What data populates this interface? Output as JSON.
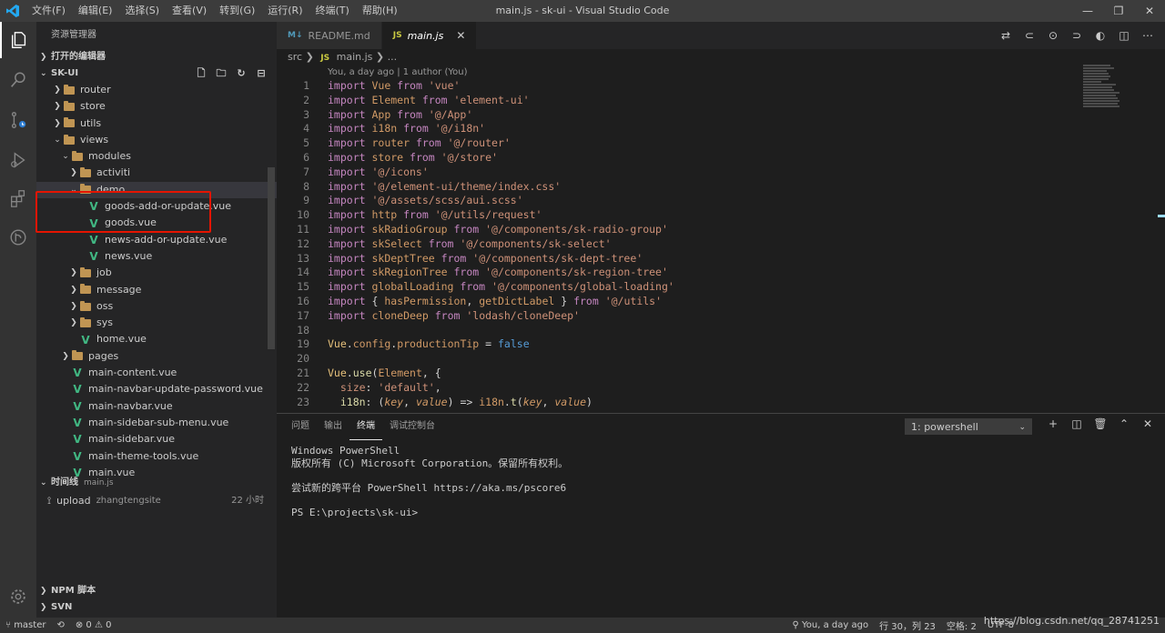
{
  "window": {
    "title": "main.js - sk-ui - Visual Studio Code",
    "menus": [
      "文件(F)",
      "编辑(E)",
      "选择(S)",
      "查看(V)",
      "转到(G)",
      "运行(R)",
      "终端(T)",
      "帮助(H)"
    ]
  },
  "sidebar": {
    "title": "资源管理器",
    "open_editors": "打开的编辑器",
    "project": "SK-UI",
    "tree": [
      {
        "label": "router",
        "type": "folder",
        "depth": 1,
        "expanded": false
      },
      {
        "label": "store",
        "type": "folder",
        "depth": 1,
        "expanded": false
      },
      {
        "label": "utils",
        "type": "folder",
        "depth": 1,
        "expanded": false
      },
      {
        "label": "views",
        "type": "folder",
        "depth": 1,
        "expanded": true
      },
      {
        "label": "modules",
        "type": "folder",
        "depth": 2,
        "expanded": true
      },
      {
        "label": "activiti",
        "type": "folder",
        "depth": 3,
        "expanded": false
      },
      {
        "label": "demo",
        "type": "folder",
        "depth": 3,
        "expanded": true
      },
      {
        "label": "goods-add-or-update.vue",
        "type": "vue",
        "depth": 4
      },
      {
        "label": "goods.vue",
        "type": "vue",
        "depth": 4
      },
      {
        "label": "news-add-or-update.vue",
        "type": "vue",
        "depth": 4
      },
      {
        "label": "news.vue",
        "type": "vue",
        "depth": 4
      },
      {
        "label": "job",
        "type": "folder",
        "depth": 3,
        "expanded": false
      },
      {
        "label": "message",
        "type": "folder",
        "depth": 3,
        "expanded": false
      },
      {
        "label": "oss",
        "type": "folder",
        "depth": 3,
        "expanded": false
      },
      {
        "label": "sys",
        "type": "folder",
        "depth": 3,
        "expanded": false
      },
      {
        "label": "home.vue",
        "type": "vue",
        "depth": 3
      },
      {
        "label": "pages",
        "type": "folder",
        "depth": 2,
        "expanded": false
      },
      {
        "label": "main-content.vue",
        "type": "vue",
        "depth": 2
      },
      {
        "label": "main-navbar-update-password.vue",
        "type": "vue",
        "depth": 2
      },
      {
        "label": "main-navbar.vue",
        "type": "vue",
        "depth": 2
      },
      {
        "label": "main-sidebar-sub-menu.vue",
        "type": "vue",
        "depth": 2
      },
      {
        "label": "main-sidebar.vue",
        "type": "vue",
        "depth": 2
      },
      {
        "label": "main-theme-tools.vue",
        "type": "vue",
        "depth": 2
      },
      {
        "label": "main.vue",
        "type": "vue",
        "depth": 2
      }
    ],
    "timeline": {
      "title": "时间线",
      "file": "main.js",
      "entry": {
        "action": "upload",
        "author": "zhangtengsite",
        "ago": "22 小时"
      }
    },
    "npm": "NPM 脚本",
    "svn": "SVN"
  },
  "tabs": [
    {
      "label": "README.md",
      "icon": "M↓",
      "active": false
    },
    {
      "label": "main.js",
      "icon": "JS",
      "active": true
    }
  ],
  "breadcrumb": {
    "folder": "src",
    "file": "main.js",
    "tail": "..."
  },
  "codelens": "You, a day ago | 1 author (You)",
  "code": [
    [
      {
        "t": "import ",
        "c": "kw"
      },
      {
        "t": "Vue ",
        "c": "id"
      },
      {
        "t": "from ",
        "c": "kw"
      },
      {
        "t": "'vue'",
        "c": "str"
      }
    ],
    [
      {
        "t": "import ",
        "c": "kw"
      },
      {
        "t": "Element ",
        "c": "id"
      },
      {
        "t": "from ",
        "c": "kw"
      },
      {
        "t": "'element-ui'",
        "c": "str"
      }
    ],
    [
      {
        "t": "import ",
        "c": "kw"
      },
      {
        "t": "App ",
        "c": "id"
      },
      {
        "t": "from ",
        "c": "kw"
      },
      {
        "t": "'@/App'",
        "c": "str"
      }
    ],
    [
      {
        "t": "import ",
        "c": "kw"
      },
      {
        "t": "i18n ",
        "c": "id"
      },
      {
        "t": "from ",
        "c": "kw"
      },
      {
        "t": "'@/i18n'",
        "c": "str"
      }
    ],
    [
      {
        "t": "import ",
        "c": "kw"
      },
      {
        "t": "router ",
        "c": "id"
      },
      {
        "t": "from ",
        "c": "kw"
      },
      {
        "t": "'@/router'",
        "c": "str"
      }
    ],
    [
      {
        "t": "import ",
        "c": "kw"
      },
      {
        "t": "store ",
        "c": "id"
      },
      {
        "t": "from ",
        "c": "kw"
      },
      {
        "t": "'@/store'",
        "c": "str"
      }
    ],
    [
      {
        "t": "import ",
        "c": "kw"
      },
      {
        "t": "'@/icons'",
        "c": "str"
      }
    ],
    [
      {
        "t": "import ",
        "c": "kw"
      },
      {
        "t": "'@/element-ui/theme/index.css'",
        "c": "str"
      }
    ],
    [
      {
        "t": "import ",
        "c": "kw"
      },
      {
        "t": "'@/assets/scss/aui.scss'",
        "c": "str"
      }
    ],
    [
      {
        "t": "import ",
        "c": "kw"
      },
      {
        "t": "http ",
        "c": "id"
      },
      {
        "t": "from ",
        "c": "kw"
      },
      {
        "t": "'@/utils/request'",
        "c": "str"
      }
    ],
    [
      {
        "t": "import ",
        "c": "kw"
      },
      {
        "t": "skRadioGroup ",
        "c": "id"
      },
      {
        "t": "from ",
        "c": "kw"
      },
      {
        "t": "'@/components/sk-radio-group'",
        "c": "str"
      }
    ],
    [
      {
        "t": "import ",
        "c": "kw"
      },
      {
        "t": "skSelect ",
        "c": "id"
      },
      {
        "t": "from ",
        "c": "kw"
      },
      {
        "t": "'@/components/sk-select'",
        "c": "str"
      }
    ],
    [
      {
        "t": "import ",
        "c": "kw"
      },
      {
        "t": "skDeptTree ",
        "c": "id"
      },
      {
        "t": "from ",
        "c": "kw"
      },
      {
        "t": "'@/components/sk-dept-tree'",
        "c": "str"
      }
    ],
    [
      {
        "t": "import ",
        "c": "kw"
      },
      {
        "t": "skRegionTree ",
        "c": "id"
      },
      {
        "t": "from ",
        "c": "kw"
      },
      {
        "t": "'@/components/sk-region-tree'",
        "c": "str"
      }
    ],
    [
      {
        "t": "import ",
        "c": "kw"
      },
      {
        "t": "globalLoading ",
        "c": "id"
      },
      {
        "t": "from ",
        "c": "kw"
      },
      {
        "t": "'@/components/global-loading'",
        "c": "str"
      }
    ],
    [
      {
        "t": "import ",
        "c": "kw"
      },
      {
        "t": "{ ",
        "c": "pl"
      },
      {
        "t": "hasPermission",
        "c": "id"
      },
      {
        "t": ", ",
        "c": "pl"
      },
      {
        "t": "getDictLabel ",
        "c": "id"
      },
      {
        "t": "} ",
        "c": "pl"
      },
      {
        "t": "from ",
        "c": "kw"
      },
      {
        "t": "'@/utils'",
        "c": "str"
      }
    ],
    [
      {
        "t": "import ",
        "c": "kw"
      },
      {
        "t": "cloneDeep ",
        "c": "id"
      },
      {
        "t": "from ",
        "c": "kw"
      },
      {
        "t": "'lodash/cloneDeep'",
        "c": "str"
      }
    ],
    [],
    [
      {
        "t": "Vue",
        "c": "cls"
      },
      {
        "t": ".",
        "c": "pl"
      },
      {
        "t": "config",
        "c": "id"
      },
      {
        "t": ".",
        "c": "pl"
      },
      {
        "t": "productionTip ",
        "c": "id"
      },
      {
        "t": "= ",
        "c": "pl"
      },
      {
        "t": "false",
        "c": "kwb"
      }
    ],
    [],
    [
      {
        "t": "Vue",
        "c": "cls"
      },
      {
        "t": ".",
        "c": "pl"
      },
      {
        "t": "use",
        "c": "fn"
      },
      {
        "t": "(",
        "c": "pl"
      },
      {
        "t": "Element",
        "c": "id"
      },
      {
        "t": ", {",
        "c": "pl"
      }
    ],
    [
      {
        "t": "  size",
        "c": "prop"
      },
      {
        "t": ": ",
        "c": "pl"
      },
      {
        "t": "'default'",
        "c": "str"
      },
      {
        "t": ",",
        "c": "pl"
      }
    ],
    [
      {
        "t": "  i18n",
        "c": "fn"
      },
      {
        "t": ": (",
        "c": "pl"
      },
      {
        "t": "key",
        "c": "id it"
      },
      {
        "t": ", ",
        "c": "pl"
      },
      {
        "t": "value",
        "c": "id it"
      },
      {
        "t": ") => ",
        "c": "pl"
      },
      {
        "t": "i18n",
        "c": "id"
      },
      {
        "t": ".",
        "c": "pl"
      },
      {
        "t": "t",
        "c": "fn"
      },
      {
        "t": "(",
        "c": "pl"
      },
      {
        "t": "key",
        "c": "id it"
      },
      {
        "t": ", ",
        "c": "pl"
      },
      {
        "t": "value",
        "c": "id it"
      },
      {
        "t": ")",
        "c": "pl"
      }
    ]
  ],
  "panel": {
    "tabs": [
      "问题",
      "输出",
      "终端",
      "调试控制台"
    ],
    "active_tab": "终端",
    "terminal_select": "1: powershell",
    "terminal_lines": [
      "Windows PowerShell",
      "版权所有 (C) Microsoft Corporation。保留所有权利。",
      "",
      "尝试新的跨平台 PowerShell https://aka.ms/pscore6",
      "",
      "PS E:\\projects\\sk-ui>"
    ]
  },
  "statusbar": {
    "branch": "master",
    "errors": "0",
    "warnings": "0",
    "blame": "You, a day ago",
    "position": "行 30，列 23",
    "spaces": "空格: 2",
    "encoding": "UTF-8",
    "eol": "CRLF",
    "language": "JavaScript"
  },
  "watermark": "https://blog.csdn.net/qq_28741251",
  "colors": {
    "accent": "#007acc",
    "highlight_box": "#e51400",
    "vue": "#41b883",
    "folder": "#c09553"
  }
}
